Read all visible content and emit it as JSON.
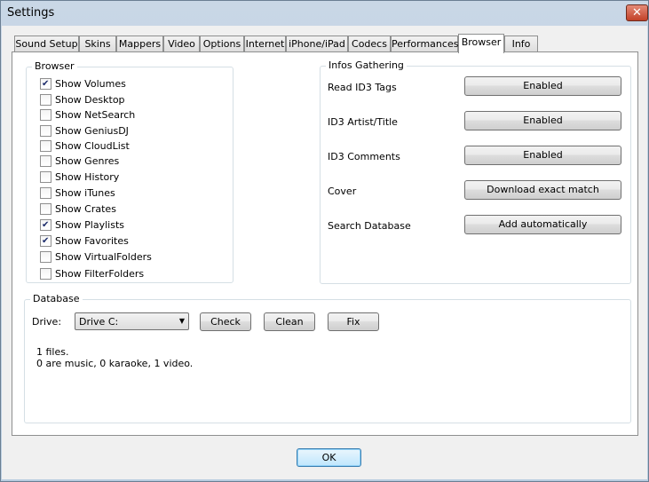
{
  "window": {
    "title": "Settings",
    "close_label": "✕"
  },
  "tabs": [
    {
      "label": "Sound Setup"
    },
    {
      "label": "Skins"
    },
    {
      "label": "Mappers"
    },
    {
      "label": "Video"
    },
    {
      "label": "Options"
    },
    {
      "label": "Internet"
    },
    {
      "label": "iPhone/iPad"
    },
    {
      "label": "Codecs"
    },
    {
      "label": "Performances"
    },
    {
      "label": "Browser",
      "active": true
    },
    {
      "label": "Info"
    }
  ],
  "browser_group": {
    "title": "Browser",
    "items": [
      {
        "label": "Show Volumes",
        "checked": true
      },
      {
        "label": "Show Desktop",
        "checked": false
      },
      {
        "label": "Show NetSearch",
        "checked": false
      },
      {
        "label": "Show GeniusDJ",
        "checked": false
      },
      {
        "label": "Show CloudList",
        "checked": false
      },
      {
        "label": "Show Genres",
        "checked": false
      },
      {
        "label": "Show History",
        "checked": false
      },
      {
        "label": "Show iTunes",
        "checked": false
      },
      {
        "label": "Show Crates",
        "checked": false
      },
      {
        "label": "Show Playlists",
        "checked": true
      },
      {
        "label": "Show Favorites",
        "checked": true
      },
      {
        "label": "Show VirtualFolders",
        "checked": false
      },
      {
        "label": "Show FilterFolders",
        "checked": false
      }
    ]
  },
  "infos_group": {
    "title": "Infos Gathering",
    "rows": [
      {
        "label": "Read ID3 Tags",
        "button": "Enabled"
      },
      {
        "label": "ID3 Artist/Title",
        "button": "Enabled"
      },
      {
        "label": "ID3 Comments",
        "button": "Enabled"
      },
      {
        "label": "Cover",
        "button": "Download exact match"
      },
      {
        "label": "Search Database",
        "button": "Add automatically"
      }
    ]
  },
  "database_group": {
    "title": "Database",
    "drive_label": "Drive:",
    "drive_value": "Drive C:",
    "check_label": "Check",
    "clean_label": "Clean",
    "fix_label": "Fix",
    "status_line1": "1 files.",
    "status_line2": "0 are music, 0 karaoke, 1 video."
  },
  "footer": {
    "ok_label": "OK"
  }
}
